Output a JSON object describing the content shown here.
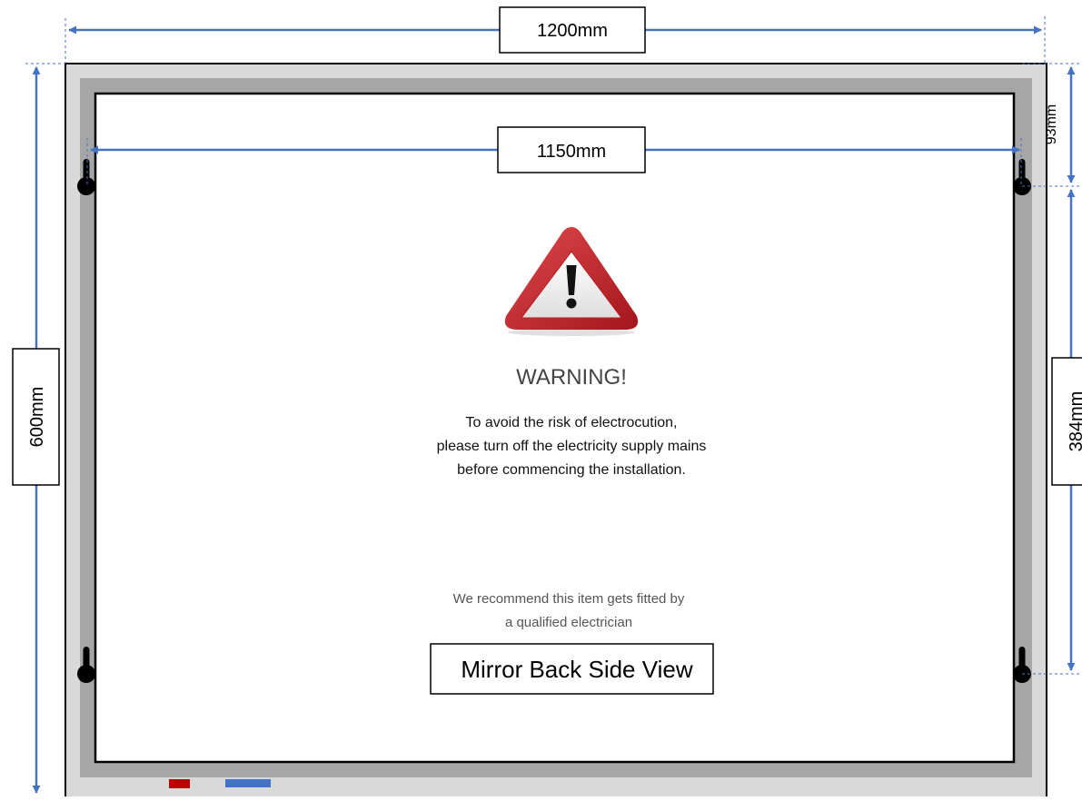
{
  "dimensions": {
    "overall_width": "1200mm",
    "inner_width": "1150mm",
    "overall_height": "600mm",
    "top_offset": "93mm",
    "hole_spacing": "384mm"
  },
  "warning": {
    "title": "WARNING!",
    "lines": [
      "To avoid the risk of electrocution,",
      "please turn off the electricity supply mains",
      "before commencing the installation."
    ],
    "recommendation": [
      "We recommend this item gets fitted by",
      "a qualified electrician"
    ]
  },
  "view_label": "Mirror Back Side View",
  "colors": {
    "frame_outer": "#d9d9d9",
    "frame_inner": "#a6a6a6",
    "dimension_line": "#4472c4",
    "warning_red": "#c0262b",
    "wire_red": "#c00000",
    "wire_blue": "#4472c4"
  },
  "icons": [
    "warning-triangle-icon",
    "keyhole-icon"
  ]
}
